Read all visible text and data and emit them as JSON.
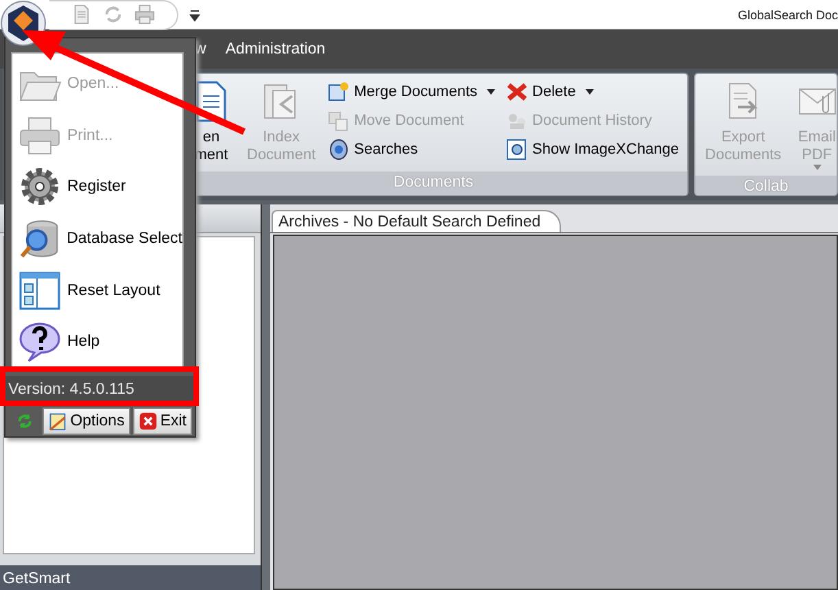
{
  "title_bar": {
    "title": "GlobalSearch Doc"
  },
  "menu_bar": {
    "tabs": [
      {
        "label": "w"
      },
      {
        "label": "Administration"
      }
    ]
  },
  "ribbon": {
    "groups": [
      {
        "label": "Documents",
        "columns": [
          {
            "kind": "large",
            "items": [
              {
                "label": "en\nment",
                "disabled": false
              }
            ]
          },
          {
            "kind": "large",
            "items": [
              {
                "label": "Index\nDocument",
                "disabled": true
              }
            ]
          },
          {
            "kind": "small",
            "items": [
              {
                "label": "Merge Documents",
                "disabled": false,
                "dropdown": true
              },
              {
                "label": "Move Document",
                "disabled": true,
                "dropdown": false
              },
              {
                "label": "Searches",
                "disabled": false,
                "dropdown": false
              }
            ]
          },
          {
            "kind": "small",
            "items": [
              {
                "label": "Delete",
                "disabled": false,
                "dropdown": true
              },
              {
                "label": "Document History",
                "disabled": true,
                "dropdown": false
              },
              {
                "label": "Show ImageXChange",
                "disabled": false,
                "dropdown": false
              }
            ]
          }
        ]
      },
      {
        "label": "Collab",
        "columns": [
          {
            "kind": "large",
            "items": [
              {
                "label": "Export\nDocuments",
                "disabled": true
              }
            ]
          },
          {
            "kind": "large",
            "items": [
              {
                "label": "Email\nPDF",
                "disabled": true,
                "dropdown": true
              }
            ]
          }
        ]
      }
    ]
  },
  "app_menu": {
    "items": [
      {
        "label": "Open...",
        "disabled": true
      },
      {
        "label": "Print...",
        "disabled": true
      },
      {
        "label": "Register",
        "disabled": false
      },
      {
        "label": "Database Select",
        "disabled": false
      },
      {
        "label": "Reset Layout",
        "disabled": false
      },
      {
        "label": "Help",
        "disabled": false
      }
    ],
    "version": "Version: 4.5.0.115",
    "buttons": [
      {
        "label": "Options"
      },
      {
        "label": "Exit"
      }
    ]
  },
  "left_pane": {
    "footer": "GetSmart"
  },
  "document_tabs": [
    {
      "label": "Archives - No Default Search Defined",
      "selected": true
    }
  ]
}
